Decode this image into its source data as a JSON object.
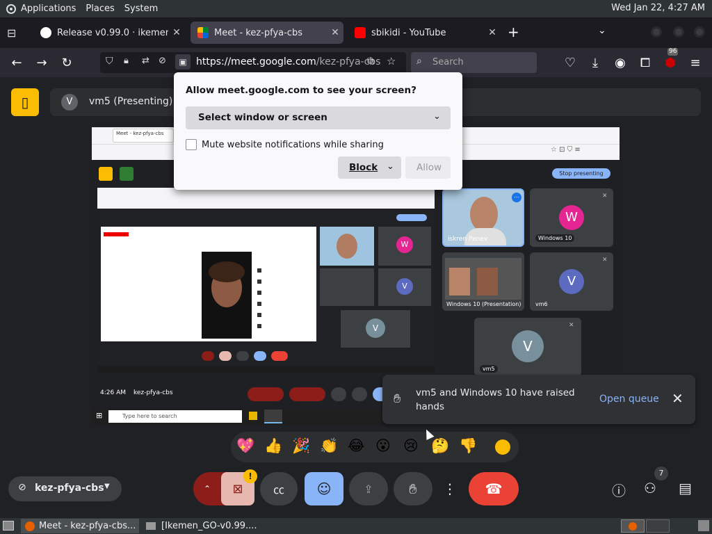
{
  "gnome_panel": {
    "menus": [
      "Applications",
      "Places",
      "System"
    ],
    "clock": "Wed Jan 22,  4:27 AM"
  },
  "browser": {
    "tabs": [
      {
        "title": "Release v0.99.0 · ikemen-er",
        "favicon": "github-icon",
        "active": false
      },
      {
        "title": "Meet - kez-pfya-cbs",
        "favicon": "meet-icon",
        "active": true
      },
      {
        "title": "sbikidi - YouTube",
        "favicon": "youtube-icon",
        "active": false
      }
    ],
    "url_host": "https://meet.google.com",
    "url_path": "/kez-pfya-cbs",
    "search_placeholder": "Search",
    "extension_badge": "96"
  },
  "share_dialog": {
    "title": "Allow meet.google.com to see your screen?",
    "select_label": "Select window or screen",
    "mute_label": "Mute website notifications while sharing",
    "block_label": "Block",
    "allow_label": "Allow"
  },
  "meet": {
    "presenter_avatar": "V",
    "presenter_label": "vm5 (Presenting)",
    "toast": {
      "message": "vm5 and Windows 10 have raised hands",
      "action": "Open queue"
    },
    "reactions": [
      "💖",
      "👍",
      "🎉",
      "👏",
      "😂",
      "😮",
      "😢",
      "🤔",
      "👎"
    ],
    "meeting_code": "kez-pfya-cbs",
    "people_count": "7",
    "warning_badge": "!"
  },
  "shared_screen": {
    "time": "4:26 AM",
    "meeting_code": "kez-pfya-cbs",
    "stop_presenting": "Stop presenting",
    "tiles": [
      {
        "name": "iskren Penev",
        "type": "video"
      },
      {
        "name": "Windows 10",
        "type": "avatar",
        "letter": "W",
        "color": "#e52592"
      },
      {
        "name": "Windows 10 (Presentation)",
        "type": "screen"
      },
      {
        "name": "vm6",
        "type": "avatar",
        "letter": "V",
        "color": "#5c6bc0"
      },
      {
        "name": "vm5",
        "type": "avatar",
        "letter": "V",
        "color": "#78909c"
      }
    ],
    "windows_search": "Type here to search"
  },
  "taskbar": {
    "items": [
      {
        "label": "Meet - kez-pfya-cbs..."
      },
      {
        "label": "[Ikemen_GO-v0.99...."
      }
    ]
  }
}
